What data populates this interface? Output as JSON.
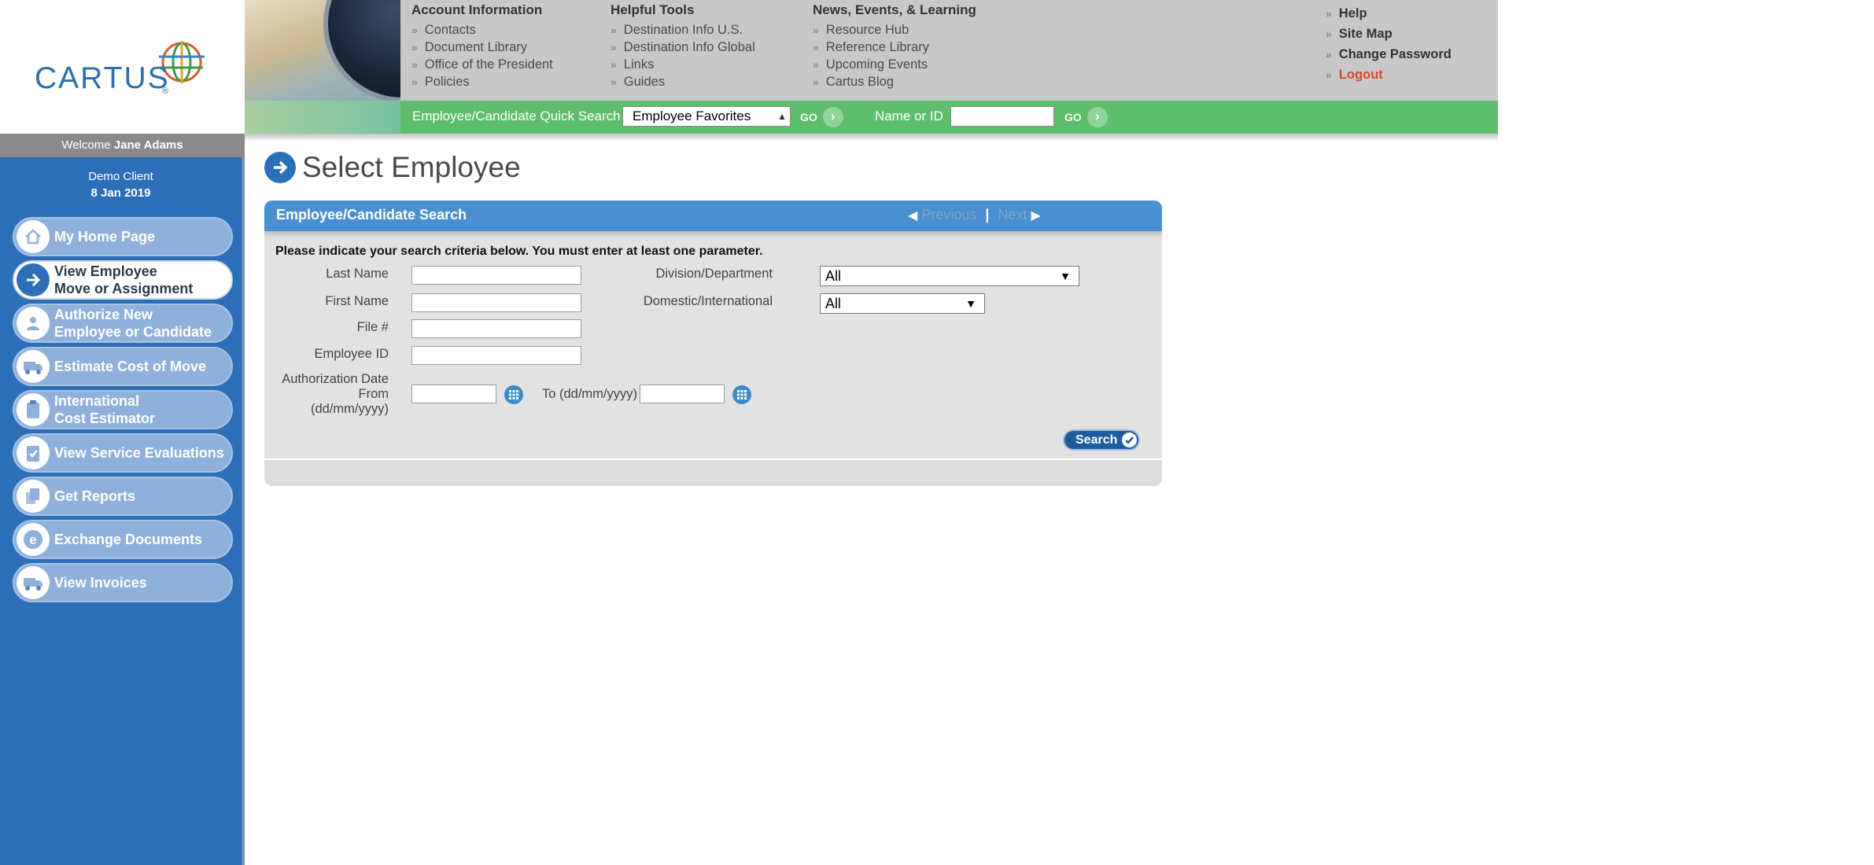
{
  "brand": {
    "logo_text": "CARTUS",
    "reg_mark": "®"
  },
  "welcome": {
    "prefix": "Welcome",
    "user": "Jane Adams"
  },
  "client": {
    "name": "Demo Client",
    "date": "8 Jan 2019"
  },
  "sidebar": {
    "items": [
      {
        "label": "My Home Page",
        "icon": "home-icon"
      },
      {
        "label": "View Employee\nMove or Assignment",
        "icon": "arrow-right-icon",
        "active": true
      },
      {
        "label": "Authorize New\nEmployee or Candidate",
        "icon": "person-icon"
      },
      {
        "label": "Estimate Cost of Move",
        "icon": "truck-icon"
      },
      {
        "label": "International\nCost Estimator",
        "icon": "clipboard-icon"
      },
      {
        "label": "View Service Evaluations",
        "icon": "clipboard-check-icon"
      },
      {
        "label": "Get Reports",
        "icon": "reports-icon"
      },
      {
        "label": "Exchange Documents",
        "icon": "document-e-icon"
      },
      {
        "label": "View Invoices",
        "icon": "truck-icon"
      }
    ]
  },
  "header": {
    "account": {
      "title": "Account Information",
      "links": [
        "Contacts",
        "Document Library",
        "Office of the President",
        "Policies"
      ]
    },
    "tools": {
      "title": "Helpful Tools",
      "links": [
        "Destination Info U.S.",
        "Destination Info Global",
        "Links",
        "Guides"
      ]
    },
    "news": {
      "title": "News, Events, & Learning",
      "links": [
        "Resource Hub",
        "Reference Library",
        "Upcoming Events",
        "Cartus Blog"
      ]
    },
    "utility": {
      "help": "Help",
      "sitemap": "Site Map",
      "change_password": "Change Password",
      "logout": "Logout"
    }
  },
  "quick_search": {
    "label": "Employee/Candidate Quick Search",
    "selected": "Employee Favorites",
    "go": "GO",
    "name_label": "Name or ID",
    "name_value": ""
  },
  "page": {
    "title": "Select Employee"
  },
  "panel": {
    "title": "Employee/Candidate Search",
    "previous": "Previous",
    "next": "Next",
    "separator": "|",
    "instructions": "Please indicate your search criteria below. You must enter at least one parameter.",
    "fields": {
      "last_name": "Last Name",
      "first_name": "First Name",
      "file_no": "File #",
      "employee_id": "Employee ID",
      "auth_date": "Authorization Date",
      "from": "From",
      "fmt": "(dd/mm/yyyy)",
      "to": "To (dd/mm/yyyy)",
      "division": "Division/Department",
      "division_value": "All",
      "domestic": "Domestic/International",
      "domestic_value": "All"
    },
    "search_button": "Search"
  },
  "colors": {
    "sidebar": "#2c6fb8",
    "quickbar": "#5fbe6e",
    "panel_header": "#4a90d0",
    "logout": "#d84a2a"
  }
}
